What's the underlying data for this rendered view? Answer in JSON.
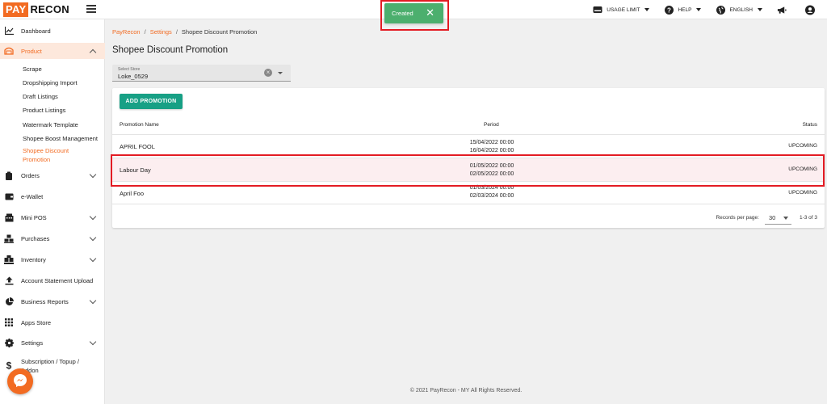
{
  "app": {
    "logo_part1": "PAY",
    "logo_part2": "RECON"
  },
  "topbar": {
    "usage_limit": "USAGE LIMIT",
    "help": "HELP",
    "language": "ENGLISH"
  },
  "toast": {
    "text": "Created",
    "close": "✕",
    "color": "#4caf6e"
  },
  "sidebar": {
    "items": [
      {
        "label": "Dashboard",
        "icon": "chart-icon"
      },
      {
        "label": "Product",
        "icon": "product-icon"
      },
      {
        "label": "Orders",
        "icon": "orders-icon"
      },
      {
        "label": "e-Wallet",
        "icon": "wallet-icon"
      },
      {
        "label": "Mini POS",
        "icon": "pos-icon"
      },
      {
        "label": "Purchases",
        "icon": "purchases-icon"
      },
      {
        "label": "Inventory",
        "icon": "inventory-icon"
      },
      {
        "label": "Account Statement Upload",
        "icon": "upload-icon"
      },
      {
        "label": "Business Reports",
        "icon": "pie-chart-icon"
      },
      {
        "label": "Apps Store",
        "icon": "grid-icon"
      },
      {
        "label": "Settings",
        "icon": "gear-icon"
      },
      {
        "label": "Subscription / Topup / Addon",
        "icon": "dollar-icon"
      }
    ],
    "product_sub": [
      "Scrape",
      "Dropshipping Import",
      "Draft Listings",
      "Product Listings",
      "Watermark Template",
      "Shopee Boost Management",
      "Shopee Discount Promotion"
    ]
  },
  "breadcrumb": {
    "root": "PayRecon",
    "parent": "Settings",
    "current": "Shopee Discount Promotion",
    "sep": "/"
  },
  "page": {
    "title": "Shopee Discount Promotion"
  },
  "store": {
    "label": "Select Store",
    "value": "Loke_0529",
    "clear": "×"
  },
  "table": {
    "add_button": "ADD PROMOTION",
    "headers": {
      "name": "Promotion Name",
      "period": "Period",
      "status": "Status"
    },
    "rows": [
      {
        "name": "APRIL FOOL",
        "start": "15/04/2022 00:00",
        "end": "16/04/2022 00:00",
        "status": "UPCOMING"
      },
      {
        "name": "Labour Day",
        "start": "01/05/2022 00:00",
        "end": "02/05/2022 00:00",
        "status": "UPCOMING"
      },
      {
        "name": "April Foo",
        "start": "01/03/2024 00:00",
        "end": "02/03/2024 00:00",
        "status": "UPCOMING"
      }
    ],
    "records_label": "Records per page:",
    "records_value": "30",
    "range": "1-3 of 3"
  },
  "footer": {
    "text": "© 2021 PayRecon - MY All Rights Reserved."
  },
  "colors": {
    "brand": "#f26b22",
    "accent": "#17a085",
    "highlight": "#e31b23"
  }
}
